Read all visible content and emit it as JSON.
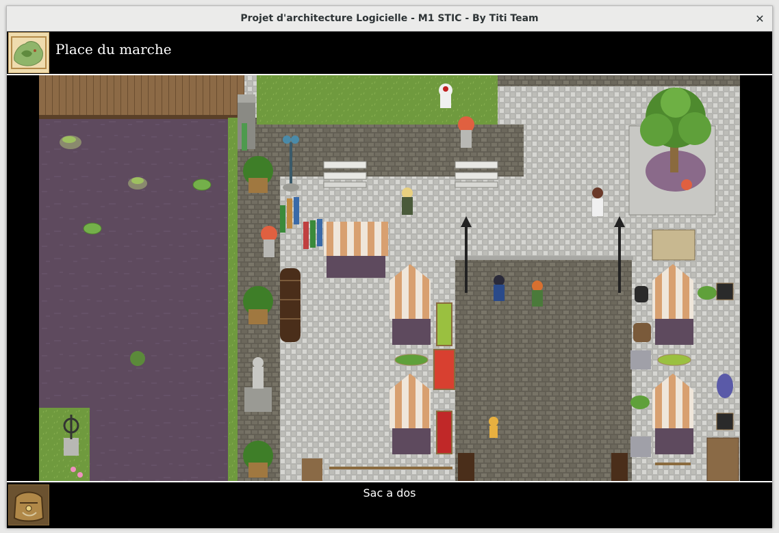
{
  "window": {
    "title": "Projet d'architecture Logicielle - M1 STIC - By Titi Team",
    "close_icon": "close-icon"
  },
  "header": {
    "location_name": "Place du marche",
    "icon": "world-map-icon"
  },
  "footer": {
    "inventory_label": "Sac a dos",
    "icon": "backpack-icon"
  },
  "colors": {
    "water": "#5e4a5e",
    "grass": "#6f9a3e",
    "stone_light": "#c8c8c4",
    "stone_dark": "#6e6a5e",
    "wood_bridge": "#8c6a46",
    "awning_stripe": "#d8a070"
  }
}
